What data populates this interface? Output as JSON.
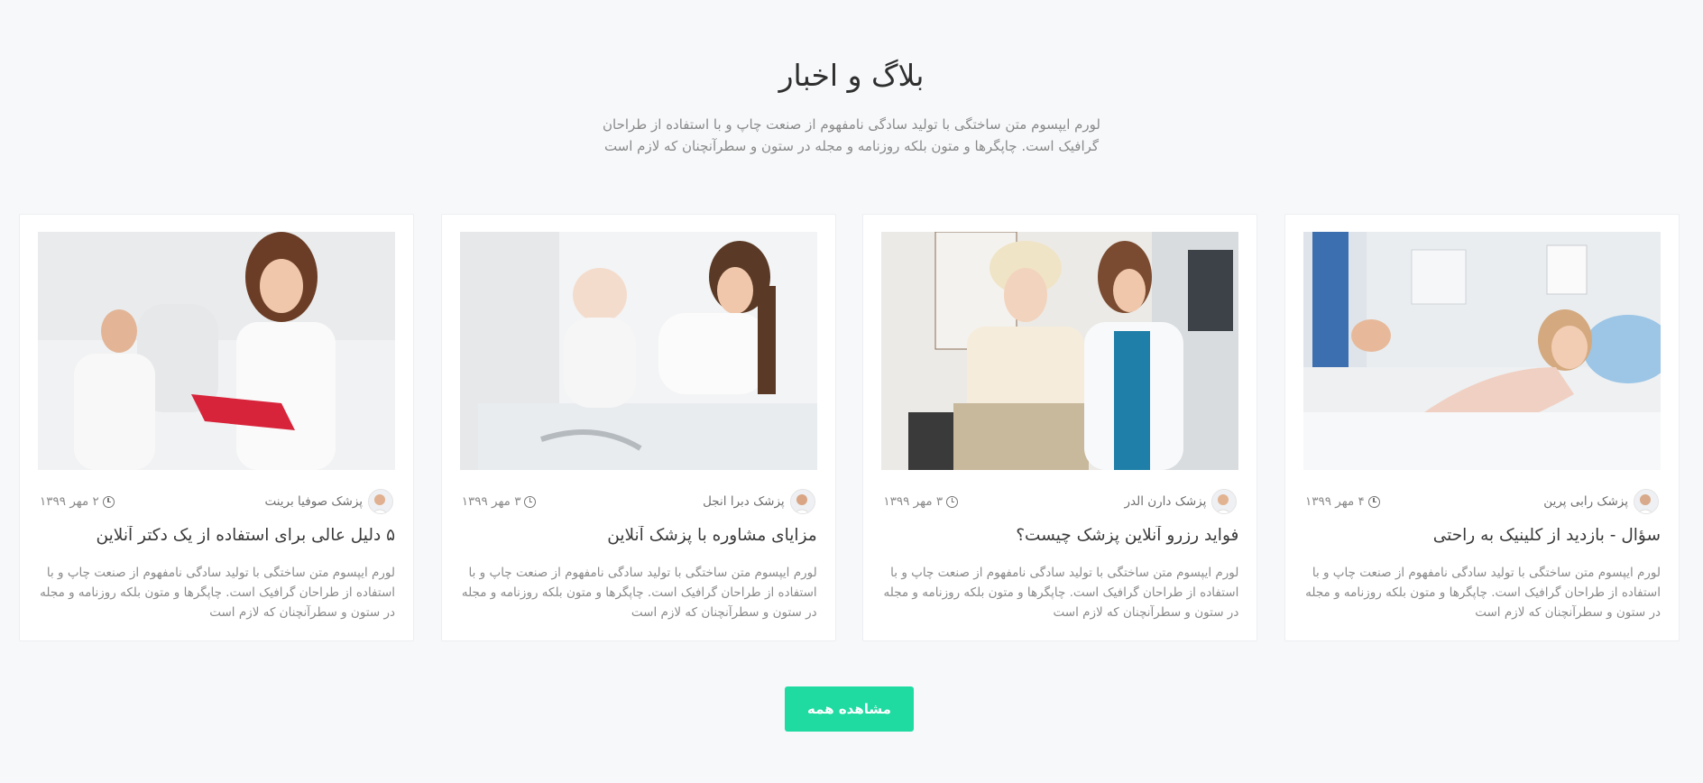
{
  "section": {
    "title": "بلاگ و اخبار",
    "subtitle": "لورم ایپسوم متن ساختگی با تولید سادگی نامفهوم از صنعت چاپ و با استفاده از طراحان گرافیک است. چاپگرها و متون بلکه روزنامه و مجله در ستون و سطرآنچنان که لازم است"
  },
  "cards": [
    {
      "author": "پزشک رابی پرین",
      "date": "۴ مهر ۱۳۹۹",
      "title": "سؤال - بازدید از کلینیک به راحتی",
      "excerpt": "لورم ایپسوم متن ساختگی با تولید سادگی نامفهوم از صنعت چاپ و با استفاده از طراحان گرافیک است. چاپگرها و متون بلکه روزنامه و مجله در ستون و سطرآنچنان که لازم است",
      "image_icon": "patient-in-bed-image"
    },
    {
      "author": "پزشک دارن الدر",
      "date": "۳ مهر ۱۳۹۹",
      "title": "فواید رزرو آنلاین پزشک چیست؟",
      "excerpt": "لورم ایپسوم متن ساختگی با تولید سادگی نامفهوم از صنعت چاپ و با استفاده از طراحان گرافیک است. چاپگرها و متون بلکه روزنامه و مجله در ستون و سطرآنچنان که لازم است",
      "image_icon": "doctor-with-elderly-woman-image"
    },
    {
      "author": "پزشک دبرا انجل",
      "date": "۳ مهر ۱۳۹۹",
      "title": "مزایای مشاوره با پزشک آنلاین",
      "excerpt": "لورم ایپسوم متن ساختگی با تولید سادگی نامفهوم از صنعت چاپ و با استفاده از طراحان گرافیک است. چاپگرها و متون بلکه روزنامه و مجله در ستون و سطرآنچنان که لازم است",
      "image_icon": "mother-with-baby-image"
    },
    {
      "author": "پزشک صوفیا برینت",
      "date": "۲ مهر ۱۳۹۹",
      "title": "۵ دلیل عالی برای استفاده از یک دکتر آنلاین",
      "excerpt": "لورم ایپسوم متن ساختگی با تولید سادگی نامفهوم از صنعت چاپ و با استفاده از طراحان گرافیک است. چاپگرها و متون بلکه روزنامه و مجله در ستون و سطرآنچنان که لازم است",
      "image_icon": "doctor-with-clipboard-image"
    }
  ],
  "actions": {
    "view_all_label": "مشاهده همه"
  },
  "colors": {
    "accent": "#1fdba2",
    "background": "#f7f8fa"
  }
}
